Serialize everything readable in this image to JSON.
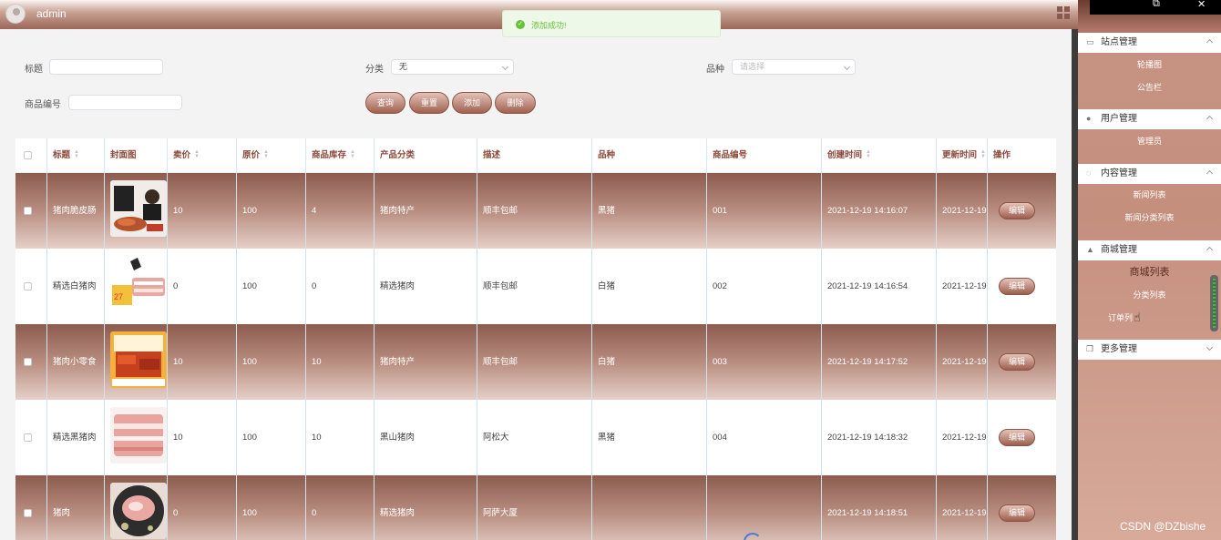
{
  "header": {
    "username": "admin"
  },
  "toast": {
    "message": "添加成功!"
  },
  "search": {
    "title_label": "标题",
    "title_value": "",
    "category_label": "分类",
    "category_value": "无",
    "variety_label": "品种",
    "variety_placeholder": "请选择",
    "code_label": "商品编号",
    "code_value": ""
  },
  "buttons": {
    "query": "查询",
    "reset": "重置",
    "add": "添加",
    "delete": "删除"
  },
  "table": {
    "headers": [
      "标题",
      "封面图",
      "卖价",
      "原价",
      "商品库存",
      "产品分类",
      "描述",
      "品种",
      "商品编号",
      "创建时间",
      "更新时间",
      "操作"
    ],
    "edit_label": "编辑",
    "rows": [
      {
        "title": "猪肉脆皮肠",
        "price": "10",
        "original": "100",
        "stock": "4",
        "category": "猪肉特产",
        "desc": "顺丰包邮",
        "variety": "黑猪",
        "code": "001",
        "created": "2021-12-19 14:16:07",
        "updated": "2021-12-19"
      },
      {
        "title": "精选白猪肉",
        "price": "0",
        "original": "100",
        "stock": "0",
        "category": "精选猪肉",
        "desc": "顺丰包邮",
        "variety": "白猪",
        "code": "002",
        "created": "2021-12-19 14:16:54",
        "updated": "2021-12-19"
      },
      {
        "title": "猪肉小零食",
        "price": "10",
        "original": "100",
        "stock": "10",
        "category": "猪肉特产",
        "desc": "顺丰包邮",
        "variety": "白猪",
        "code": "003",
        "created": "2021-12-19 14:17:52",
        "updated": "2021-12-19"
      },
      {
        "title": "精选黑猪肉",
        "price": "10",
        "original": "100",
        "stock": "10",
        "category": "黑山猪肉",
        "desc": "阿松大",
        "variety": "黑猪",
        "code": "004",
        "created": "2021-12-19 14:18:32",
        "updated": "2021-12-19"
      },
      {
        "title": "猪肉",
        "price": "0",
        "original": "100",
        "stock": "0",
        "category": "精选猪肉",
        "desc": "阿萨大厦",
        "variety": "",
        "code": "",
        "created": "2021-12-19 14:18:51",
        "updated": "2021-12-19"
      }
    ]
  },
  "sidebar": {
    "groups": [
      {
        "label": "站点管理",
        "items": [
          "轮播图",
          "公告栏"
        ]
      },
      {
        "label": "用户管理",
        "items": [
          "管理员"
        ]
      },
      {
        "label": "内容管理",
        "items": [
          "新闻列表",
          "新闻分类列表"
        ]
      },
      {
        "label": "商城管理",
        "items": [
          "商城列表",
          "分类列表",
          "订单列"
        ]
      },
      {
        "label": "更多管理",
        "items": []
      }
    ]
  },
  "watermark": "CSDN @DZbishe"
}
